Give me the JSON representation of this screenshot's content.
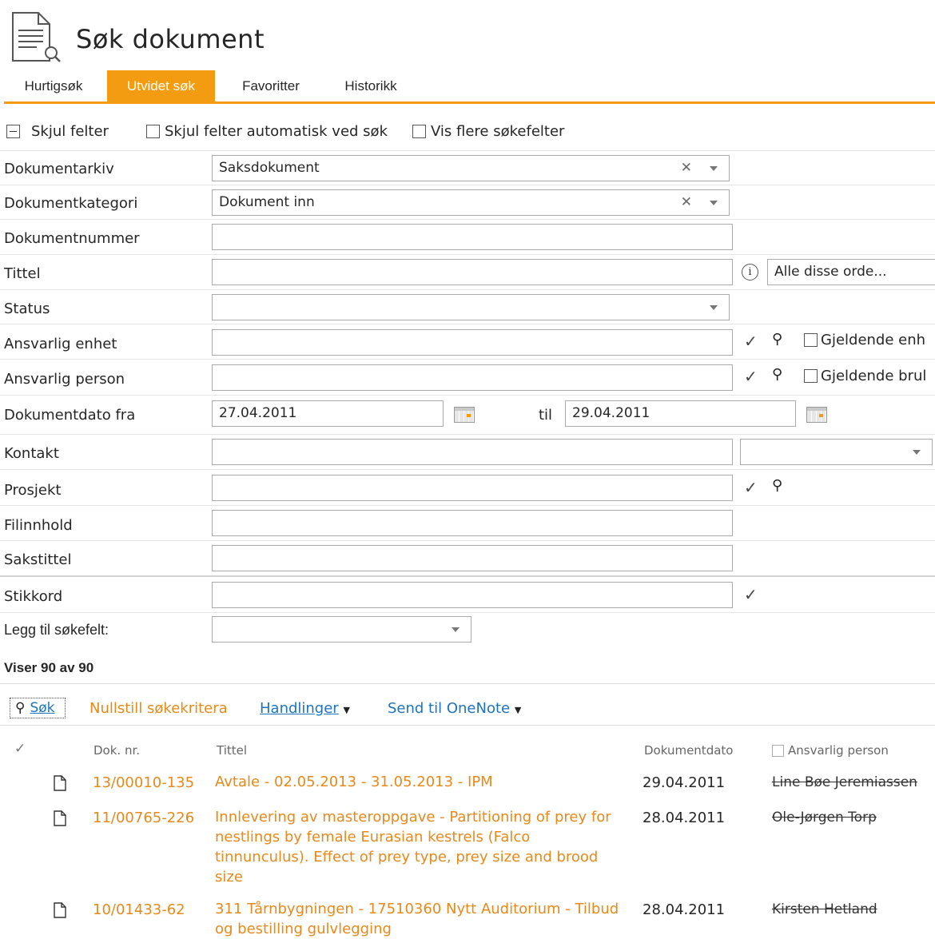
{
  "header": {
    "title": "Søk dokument",
    "icon": "search-document-icon"
  },
  "tabs": [
    {
      "label": "Hurtigsøk",
      "active": false
    },
    {
      "label": "Utvidet søk",
      "active": true
    },
    {
      "label": "Favoritter",
      "active": false
    },
    {
      "label": "Historikk",
      "active": false
    }
  ],
  "options": {
    "hide_fields": "Skjul felter",
    "auto_hide": "Skjul felter automatisk ved søk",
    "more_fields": "Vis flere søkefelter"
  },
  "form": {
    "dokumentarkiv": {
      "label": "Dokumentarkiv",
      "value": "Saksdokument"
    },
    "dokumentkategori": {
      "label": "Dokumentkategori",
      "value": "Dokument inn"
    },
    "dokumentnummer": {
      "label": "Dokumentnummer",
      "value": ""
    },
    "tittel": {
      "label": "Tittel",
      "value": "",
      "mode": "Alle disse orde..."
    },
    "status": {
      "label": "Status",
      "value": ""
    },
    "ansvarlig_enhet": {
      "label": "Ansvarlig enhet",
      "value": "",
      "checkbox": "Gjeldende enh"
    },
    "ansvarlig_person": {
      "label": "Ansvarlig person",
      "value": "",
      "checkbox": "Gjeldende brul"
    },
    "dokumentdato": {
      "label": "Dokumentdato fra",
      "from": "27.04.2011",
      "to_label": "til",
      "to": "29.04.2011"
    },
    "kontakt": {
      "label": "Kontakt",
      "value": ""
    },
    "prosjekt": {
      "label": "Prosjekt",
      "value": ""
    },
    "filinnhold": {
      "label": "Filinnhold",
      "value": ""
    },
    "sakstittel": {
      "label": "Sakstittel",
      "value": ""
    },
    "stikkord": {
      "label": "Stikkord",
      "value": ""
    },
    "legg_til": {
      "label": "Legg til søkefelt:",
      "value": ""
    }
  },
  "results": {
    "count": "Viser 90 av 90",
    "toolbar": {
      "search": "Søk",
      "reset": "Nullstill søkekritera",
      "actions": "Handlinger",
      "onenote": "Send til OneNote"
    },
    "columns": {
      "check": "✓",
      "doknr": "Dok. nr.",
      "title": "Tittel",
      "date": "Dokumentdato",
      "person": "Ansvarlig person"
    },
    "rows": [
      {
        "doknr": "13/00010-135",
        "title": "Avtale - 02.05.2013 - 31.05.2013 - IPM",
        "date": "29.04.2011",
        "person": "Line Bøe Jeremiassen"
      },
      {
        "doknr": "11/00765-226",
        "title": "Innlevering av masteroppgave - Partitioning of prey for nestlings by female Eurasian kestrels (Falco tinnunculus). Effect of prey type, prey size and brood size",
        "date": "28.04.2011",
        "person": "Ole-Jørgen Torp"
      },
      {
        "doknr": "10/01433-62",
        "title": "311 Tårnbygningen - 17510360 Nytt Auditorium - Tilbud og bestilling gulvlegging",
        "date": "28.04.2011",
        "person": "Kirsten Hetland"
      }
    ]
  },
  "colors": {
    "accent": "#f39c12",
    "link_orange": "#e8891a",
    "link_blue": "#1e73be"
  }
}
